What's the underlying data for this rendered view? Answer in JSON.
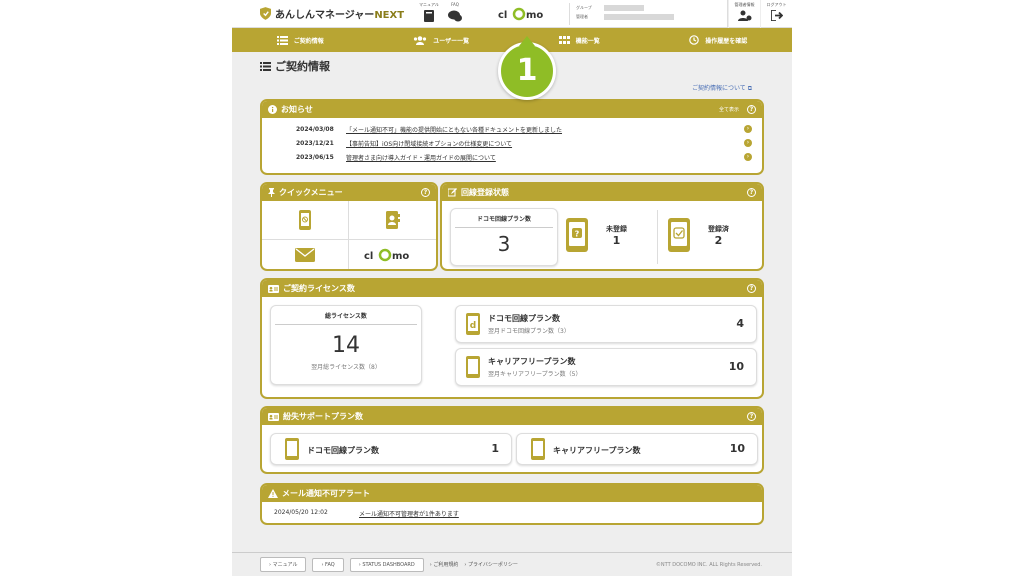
{
  "header": {
    "brand": "あんしんマネージャー",
    "brand_next": "NEXT",
    "manual_label": "マニュアル",
    "faq_label": "FAQ",
    "clomo_logo": "CLOMO",
    "group_label": "グループ",
    "admin_label": "管理者",
    "admin_info_label": "管理者情報",
    "logout_label": "ログアウト"
  },
  "nav": {
    "contract": "ご契約情報",
    "users": "ユーザー一覧",
    "functions": "機能一覧",
    "history": "操作履歴を確認"
  },
  "badge": "1",
  "page": {
    "title": "ご契約情報",
    "about_link": "ご契約情報について"
  },
  "news": {
    "title": "お知らせ",
    "show_all": "全て表示",
    "items": [
      {
        "date": "2024/03/08",
        "title": "「メール通知不可」機能の提供開始にともない各種ドキュメントを更新しました"
      },
      {
        "date": "2023/12/21",
        "title": "【事前告知】iOS向け閉域接続オプションの仕様変更について"
      },
      {
        "date": "2023/06/15",
        "title": "管理者さま向け導入ガイド・運用ガイドの展開について"
      }
    ]
  },
  "quick_menu": {
    "title": "クイックメニュー"
  },
  "line_status": {
    "title": "回線登録状態",
    "docomo_plan_label": "ドコモ回線プラン数",
    "docomo_plan_count": "3",
    "unregistered_label": "未登録",
    "unregistered_count": "1",
    "registered_label": "登録済",
    "registered_count": "2"
  },
  "license": {
    "title": "ご契約ライセンス数",
    "total_label": "総ライセンス数",
    "total_count": "14",
    "total_next": "翌月総ライセンス数（8）",
    "docomo_label": "ドコモ回線プラン数",
    "docomo_next": "翌月ドコモ回線プラン数（3）",
    "docomo_count": "4",
    "carrier_label": "キャリアフリープラン数",
    "carrier_next": "翌月キャリアフリープラン数（5）",
    "carrier_count": "10"
  },
  "lost_support": {
    "title": "紛失サポートプラン数",
    "docomo_label": "ドコモ回線プラン数",
    "docomo_count": "1",
    "carrier_label": "キャリアフリープラン数",
    "carrier_count": "10"
  },
  "alert": {
    "title": "メール通知不可アラート",
    "date": "2024/05/20 12:02",
    "message": "メール通知不可管理者が1件あります"
  },
  "footer": {
    "manual": "マニュアル",
    "faq": "FAQ",
    "status": "STATUS DASHBOARD",
    "terms": "ご利用規約",
    "privacy": "プライバシーポリシー",
    "copyright": "©NTT DOCOMO INC. ALL Rights Reserved."
  },
  "colors": {
    "accent": "#b8a533",
    "badge": "#8fbd26",
    "background": "#eeeeee"
  }
}
